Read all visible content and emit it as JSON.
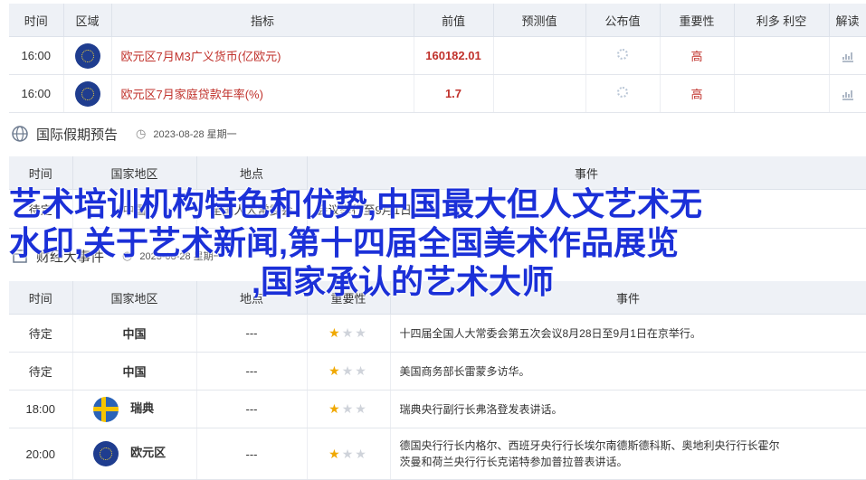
{
  "table1": {
    "headers": [
      "时间",
      "区域",
      "指标",
      "前值",
      "预测值",
      "公布值",
      "重要性",
      "利多 利空",
      "解读"
    ],
    "rows": [
      {
        "time": "16:00",
        "flag": "eu-flag",
        "indicator": "欧元区7月M3广义货币(亿欧元)",
        "prev": "160182.01",
        "importance": "高"
      },
      {
        "time": "16:00",
        "flag": "eu-flag",
        "indicator": "欧元区7月家庭贷款年率(%)",
        "prev": "1.7",
        "importance": "高"
      }
    ]
  },
  "holiday": {
    "title": "国际假期预告",
    "date": "2023-08-28 星期一"
  },
  "table2": {
    "headers": [
      "时间",
      "国家地区",
      "地点",
      "事件"
    ],
    "row": {
      "time": "待定",
      "region": "中国",
      "place": "全国人大常委会",
      "event": "会议举行至9月1日。"
    }
  },
  "events_section": {
    "title": "财经大事件",
    "date": "2023-08-28 星期一"
  },
  "table3": {
    "headers": [
      "时间",
      "国家地区",
      "地点",
      "重要性",
      "事件"
    ],
    "rows": [
      {
        "time": "待定",
        "region": "中国",
        "place": "---",
        "stars": 1,
        "event": "十四届全国人大常委会第五次会议8月28日至9月1日在京举行。"
      },
      {
        "time": "待定",
        "region": "中国",
        "place": "---",
        "stars": 1,
        "event": "美国商务部长雷蒙多访华。"
      },
      {
        "time": "18:00",
        "flag": "se-flag",
        "region": "瑞典",
        "place": "---",
        "stars": 1,
        "event": "瑞典央行副行长弗洛登发表讲话。"
      },
      {
        "time": "20:00",
        "flag": "eu-flag",
        "region": "欧元区",
        "place": "---",
        "stars": 1,
        "event_line1": "德国央行行长内格尔、西班牙央行行长埃尔南德斯德科斯、奥地利央行行长霍尔",
        "event_line2": "茨曼和荷兰央行行长克诺特参加普拉普表讲话。"
      }
    ]
  },
  "overlay": {
    "line1": "艺术培训机构特色和优势,中国最大但人文艺术无",
    "line2": "水印,关于艺术新闻,第十四届全国美术作品展览",
    "line3": ",国家承认的艺术大师"
  },
  "colors": {
    "header_bg": "#eef1f6",
    "red": "#c0312b",
    "overlay_blue": "#1b30d8",
    "star": "#f0a800"
  }
}
